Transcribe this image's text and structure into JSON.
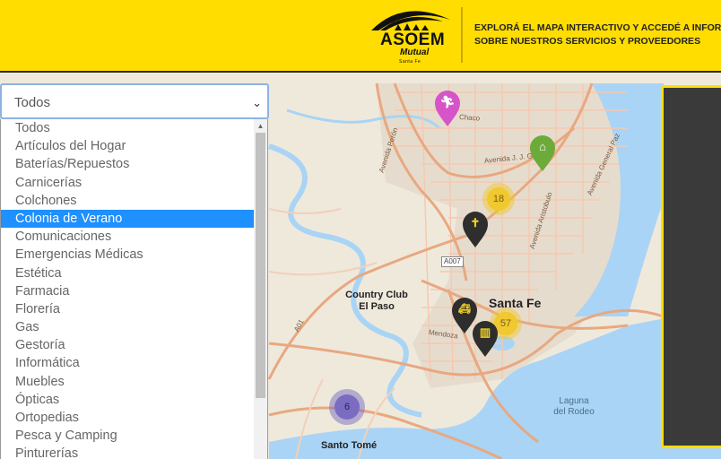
{
  "header": {
    "logo_name": "ASOEM",
    "logo_sub": "Mutual",
    "logo_location": "Santa Fe",
    "tagline_line1": "EXPLORÁ EL MAPA INTERACTIVO Y ACCEDÉ A INFORM",
    "tagline_line2": "SOBRE NUESTROS SERVICIOS Y PROVEEDORES",
    "background": "#ffdd00"
  },
  "category_select": {
    "selected_value": "Todos",
    "highlighted_option": "Colonia de Verano",
    "options": [
      "Todos",
      "Artículos del Hogar",
      "Baterías/Repuestos",
      "Carnicerías",
      "Colchones",
      "Colonia de Verano",
      "Comunicaciones",
      "Emergencias Médicas",
      "Estética",
      "Farmacia",
      "Florería",
      "Gas",
      "Gestoría",
      "Informática",
      "Muebles",
      "Ópticas",
      "Ortopedias",
      "Pesca y Camping",
      "Pinturerías"
    ]
  },
  "map": {
    "labels": {
      "santa_fe": "Santa Fe",
      "country_club": "Country Club\nEl Paso",
      "santo_tome": "Santo Tomé",
      "laguna": "Laguna\ndel Rodeo",
      "route_tag": "A007"
    },
    "streets": {
      "j_j_gomez": "Avenida J. J. Gomez",
      "aristobulo": "Avenida Aristobulo",
      "general_paz": "Avenida General Paz",
      "peron": "Avenida Perón",
      "mendoza": "Mendoza",
      "chaco": "Chaco",
      "a01": "A01"
    },
    "clusters": {
      "north": "18",
      "center": "57",
      "santo_tome": "6"
    },
    "markers": {
      "runner": "running-icon",
      "home": "home-icon",
      "cross": "cross-icon",
      "ambulance": "ambulance-icon",
      "building": "building-icon"
    },
    "colors": {
      "water": "#a9d4f5",
      "road": "#e8a880",
      "cluster_yellow": "#f0c830",
      "cluster_purple": "#7a6cc0",
      "marker_pink": "#d654c8",
      "marker_green": "#6cab3a",
      "marker_dark": "#2e2e2e"
    }
  }
}
